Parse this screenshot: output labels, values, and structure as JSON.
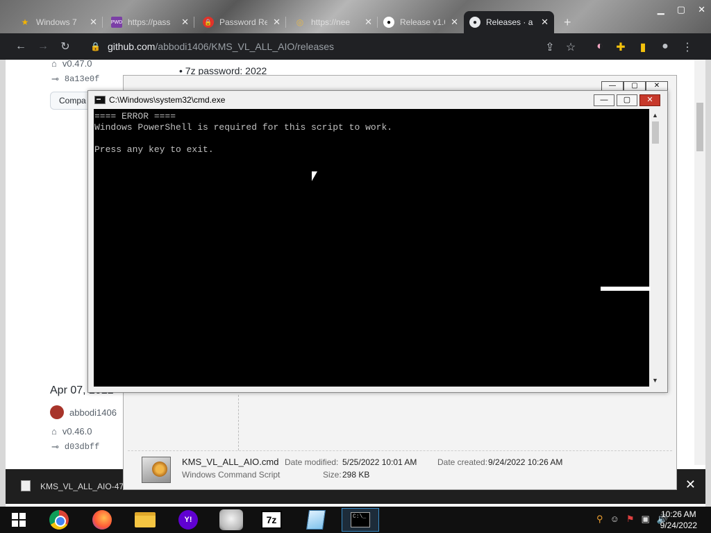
{
  "browser": {
    "tabs": [
      {
        "title": "Windows 7",
        "icon": "star-icon"
      },
      {
        "title": "https://pass",
        "icon": "pwd-icon"
      },
      {
        "title": "Password Re",
        "icon": "lock-icon"
      },
      {
        "title": "https://nee",
        "icon": "globe-icon"
      },
      {
        "title": "Release v1.0",
        "icon": "github-icon"
      },
      {
        "title": "Releases · a",
        "icon": "github-icon"
      }
    ],
    "new_tab": "+",
    "url_host": "github.com",
    "url_path": "/abbodi1406/KMS_VL_ALL_AIO/releases"
  },
  "page": {
    "password_line": "7z password: 2022",
    "tag_top": "v0.47.0",
    "commit_top": "8a13e0f",
    "compare_label": "Compa",
    "release_date": "Apr 07, 2022",
    "author": "abbodi1406",
    "tag_bottom": "v0.46.0",
    "commit_bottom": "d03dbff"
  },
  "download_bar": {
    "file_name": "KMS_VL_ALL_AIO-47"
  },
  "explorer": {
    "file_name": "KMS_VL_ALL_AIO.cmd",
    "file_type": "Windows Command Script",
    "date_modified_label": "Date modified:",
    "date_modified": "5/25/2022 10:01 AM",
    "size_label": "Size:",
    "size": "298 KB",
    "date_created_label": "Date created:",
    "date_created": "9/24/2022 10:26 AM"
  },
  "cmd": {
    "title": "C:\\Windows\\system32\\cmd.exe",
    "output": "==== ERROR ====\nWindows PowerShell is required for this script to work.\n\nPress any key to exit."
  },
  "taskbar": {
    "apps": [
      "start-icon",
      "chrome-icon",
      "firefox-icon",
      "file-explorer-icon",
      "yahoo-icon",
      "cat-image-icon",
      "7zip-icon",
      "notepad-icon",
      "cmd-icon"
    ],
    "yahoo_label": "Y!",
    "sevenz_label": "7z",
    "cmd_label": "C:\\_",
    "time": "10:26 AM",
    "date": "9/24/2022"
  }
}
